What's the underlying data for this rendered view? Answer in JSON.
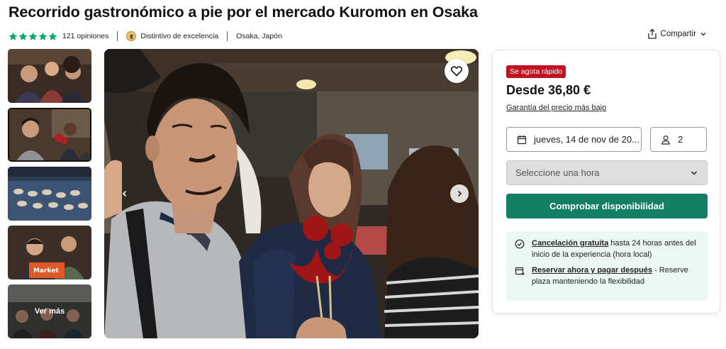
{
  "title": "Recorrido gastronómico a pie por el mercado Kuromon en Osaka",
  "meta": {
    "rating_stars": 5,
    "rating_color": "#00aa6c",
    "reviews": "121 opiniones",
    "badge_icon": "award-badge-icon",
    "badge": "Distintivo de excelencia",
    "location": "Osaka, Japón"
  },
  "share": {
    "label": "Compartir",
    "icon": "share-icon"
  },
  "gallery": {
    "thumbnails": [
      {
        "label": ""
      },
      {
        "label": ""
      },
      {
        "label": ""
      },
      {
        "label": ""
      },
      {
        "label": "Ver más"
      }
    ],
    "selected_index": 1
  },
  "booking": {
    "urgency_badge": "Se agota rápido",
    "urgency_color": "#c1121f",
    "price": "Desde 36,80 €",
    "guarantee": "Garantía del precio más bajo",
    "date": "jueves, 14 de nov de 20...",
    "date_icon": "calendar-icon",
    "travelers": "2",
    "travelers_icon": "person-icon",
    "time_placeholder": "Seleccione una hora",
    "cta": "Comprobar disponibilidad",
    "cta_color": "#138063",
    "cancellation_link": "Cancelación gratuita",
    "cancellation_text": " hasta 24 horas antes del inicio de la experiencia (hora local)",
    "reserve_link": "Reservar ahora y pagar después",
    "reserve_text": " - Reserve plaza manteniendo la flexibilidad"
  }
}
